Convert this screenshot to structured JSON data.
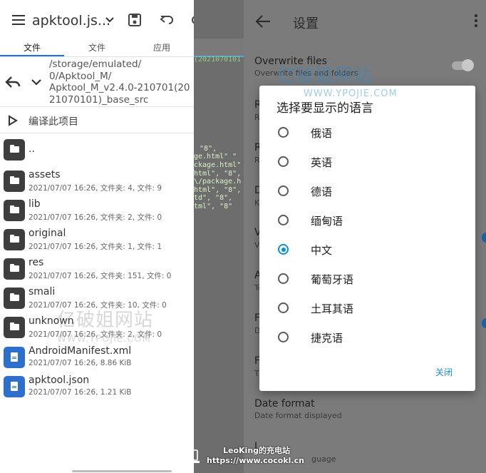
{
  "left": {
    "app_title": "apktool.js...",
    "tabs": [
      "文件",
      "文件",
      "应用"
    ],
    "path_lines": [
      "/storage/emulated/",
      "0/Apktool_M/",
      "Apktool_M_v2.4.0-210701(20",
      "21070101)_base_src"
    ],
    "compile_label": "编译此项目",
    "parent_dir": "..",
    "files": [
      {
        "name": "assets",
        "meta": "2021/07/07 16:26, 文件夹: 4, 文件: 9",
        "type": "folder"
      },
      {
        "name": "lib",
        "meta": "2021/07/07 16:26, 文件夹: 2, 文件: 0",
        "type": "folder"
      },
      {
        "name": "original",
        "meta": "2021/07/07 16:26, 文件夹: 1, 文件: 1",
        "type": "folder"
      },
      {
        "name": "res",
        "meta": "2021/07/07 16:26, 文件夹: 151, 文件: 0",
        "type": "folder"
      },
      {
        "name": "smali",
        "meta": "2021/07/07 16:26, 文件夹: 10, 文件: 0",
        "type": "folder"
      },
      {
        "name": "unknown",
        "meta": "2021/07/07 16:26, 文件夹: 2, 文件: 0",
        "type": "folder"
      },
      {
        "name": "AndroidManifest.xml",
        "meta": "2021/07/07 16:26, 8.86 KiB",
        "type": "file"
      },
      {
        "name": "apktool.json",
        "meta": "2021/07/07 16:26, 1.21 KiB",
        "type": "file"
      }
    ]
  },
  "code": {
    "lines": [
      "(2021070101",
      "\"8\",",
      "ge.html\" \"",
      "ckage.html\"",
      "html\", \"8\",",
      "\\/package.h",
      "html\", \"8\",",
      "td\", \"8\",",
      "tml\", \"8\""
    ]
  },
  "settings": {
    "title": "设置",
    "items": [
      {
        "title": "Overwrite files",
        "subtitle": "Overwrite files and folders"
      },
      {
        "title": "R",
        "subtitle": "R"
      },
      {
        "title": "R",
        "subtitle": "R"
      },
      {
        "title": "D",
        "subtitle": "K"
      },
      {
        "title": "V",
        "subtitle": "V"
      },
      {
        "title": "A",
        "subtitle": "To"
      },
      {
        "title": "F",
        "subtitle": "D"
      },
      {
        "title": "F",
        "subtitle": "Th"
      },
      {
        "title": "Date format",
        "subtitle": "Date format displayed"
      },
      {
        "title": "L",
        "subtitle": "guage"
      }
    ]
  },
  "dialog": {
    "title": "选择要显示的语言",
    "options": [
      "俄语",
      "英语",
      "德语",
      "缅甸语",
      "中文",
      "葡萄牙语",
      "土耳其语",
      "捷克语"
    ],
    "selected_index": 4,
    "close_label": "关闭"
  },
  "watermark": {
    "cn": "亿破姐网站",
    "url": "WWW.YPOJIE.COM"
  },
  "credit": {
    "line1": "LeoKing的充电站",
    "line2": "https://www.cocokl.cn"
  },
  "colors": {
    "accent": "#1a73e8",
    "radio_selected": "#0a8fd8",
    "doc_icon": "#2d6fcf",
    "folder_icon": "#3e3e3e"
  }
}
